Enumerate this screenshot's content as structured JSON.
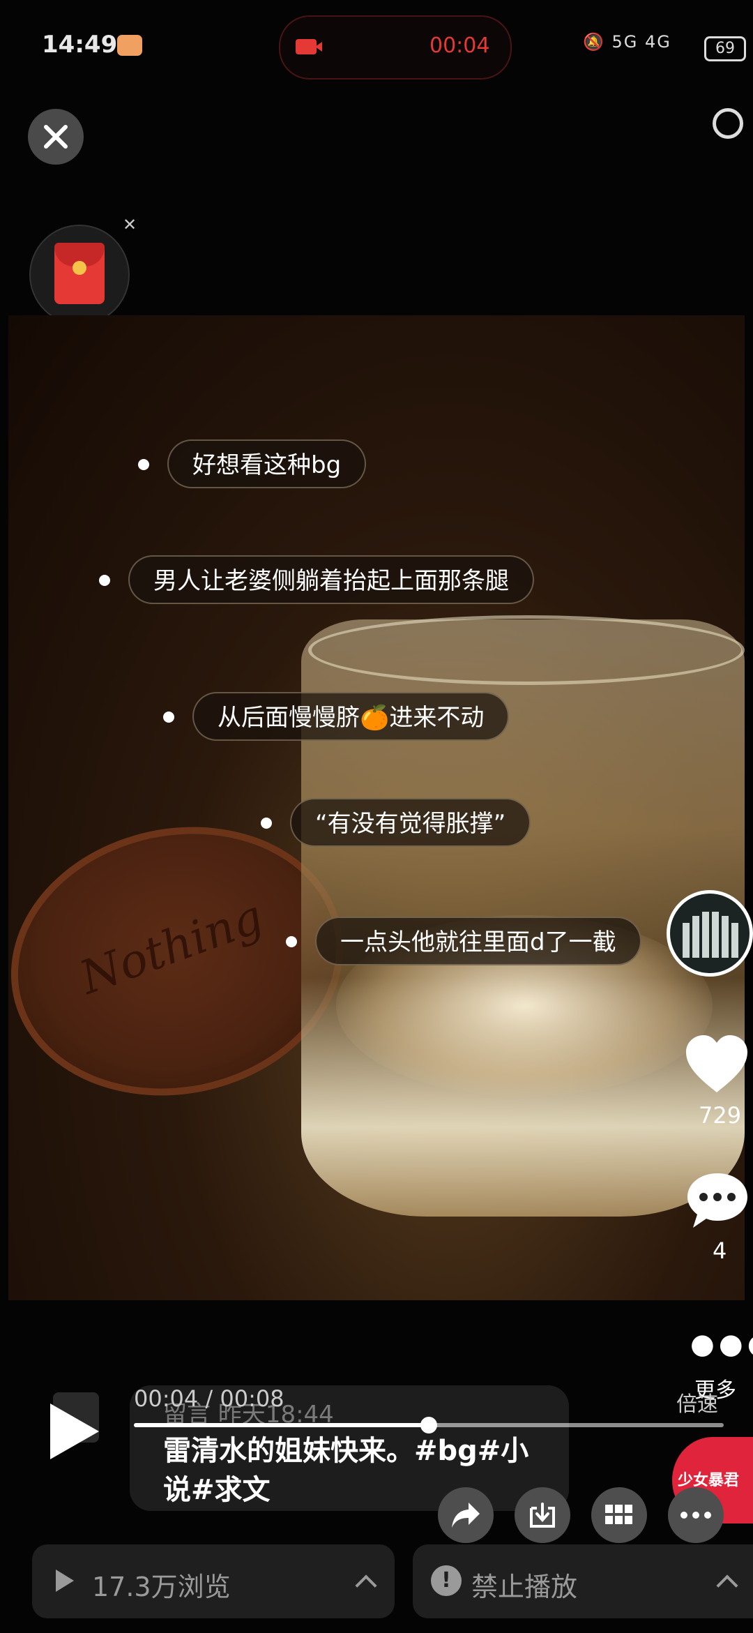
{
  "status_bar": {
    "time": "14:49",
    "recording_time": "00:04",
    "signal": "5G 4G",
    "battery": "69"
  },
  "video": {
    "coaster_text": "Nothing",
    "comments": [
      "好想看这种bg",
      "男人让老婆侧躺着抬起上面那条腿",
      "从后面慢慢脐🍊进来不动",
      "“有没有觉得胀撑”",
      "一点头他就往里面d了一截"
    ]
  },
  "actions": {
    "like_count": "729",
    "comment_count": "4",
    "more_label": "更多",
    "album_text": "少女暴君"
  },
  "player": {
    "time": "00:04 / 00:08",
    "progress": 0.5,
    "speed_label": "倍速"
  },
  "caption": {
    "meta": "留言  昨天18:44",
    "text": "雷清水的姐妹快来。#bg#小说#求文"
  },
  "bottom": {
    "views": "17.3万浏览",
    "ban": "禁止播放"
  },
  "colors": {
    "record_red": "#e53935",
    "redpacket": "#e53935"
  }
}
